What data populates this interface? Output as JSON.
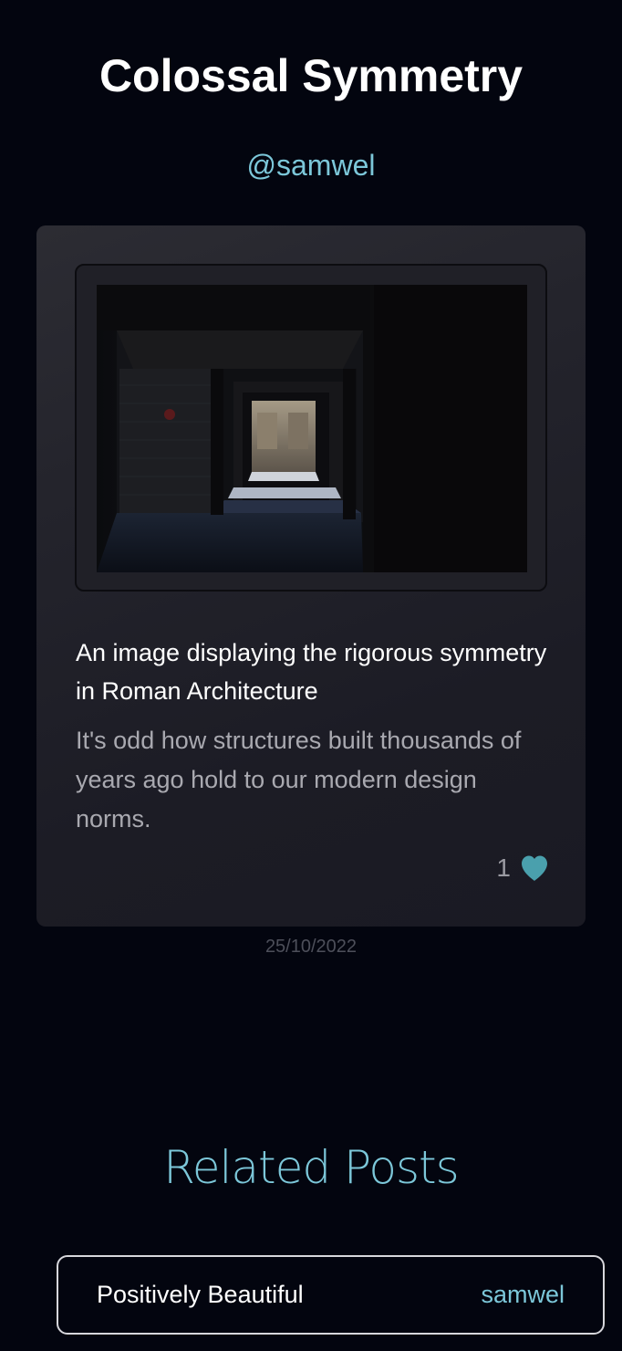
{
  "post": {
    "title": "Colossal Symmetry",
    "author": "@samwel",
    "image_alt": "An image displaying the rigorous symmetry in Roman Architecture",
    "heading": "An image displaying the rigorous symmetry in Roman Architecture",
    "body": "It's odd how structures built thousands of years ago hold to our modern design norms.",
    "likes": "1",
    "date": "25/10/2022"
  },
  "related": {
    "heading": "Related Posts",
    "items": [
      {
        "title": "Positively Beautiful",
        "author": "samwel"
      }
    ]
  },
  "colors": {
    "background": "#03050f",
    "accent": "#7cc7d9",
    "heart": "#4aa0ad",
    "card": "#24242c"
  },
  "icons": {
    "like": "heart-icon"
  }
}
